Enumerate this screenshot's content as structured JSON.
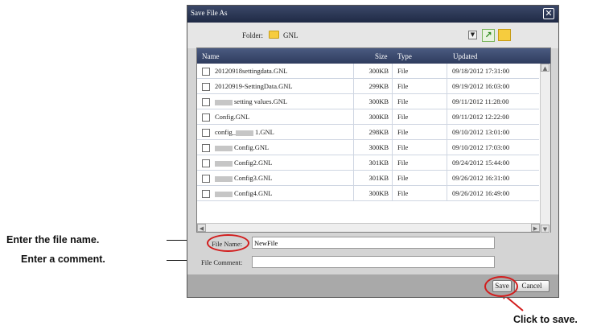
{
  "dialog": {
    "title": "Save File As",
    "close_glyph": "✕"
  },
  "folder": {
    "label": "Folder:",
    "value": "GNL",
    "dropdown_glyph": "▼",
    "up_glyph": "↗"
  },
  "list": {
    "columns": {
      "name": "Name",
      "size": "Size",
      "type": "Type",
      "updated": "Updated"
    },
    "rows": [
      {
        "name": "20120918settingdata.GNL",
        "size": "300KB",
        "type": "File",
        "updated": "09/18/2012 17:31:00"
      },
      {
        "name": "20120919-SettingData.GNL",
        "size": "299KB",
        "type": "File",
        "updated": "09/19/2012 16:03:00"
      },
      {
        "name": "setting values.GNL",
        "size": "300KB",
        "type": "File",
        "updated": "09/11/2012 11:28:00"
      },
      {
        "name": "Config.GNL",
        "size": "300KB",
        "type": "File",
        "updated": "09/11/2012 12:22:00"
      },
      {
        "name": "config_",
        "name_suffix": "1.GNL",
        "size": "298KB",
        "type": "File",
        "updated": "09/10/2012 13:01:00"
      },
      {
        "name": "Config.GNL",
        "size": "300KB",
        "type": "File",
        "updated": "09/10/2012 17:03:00"
      },
      {
        "name": "Config2.GNL",
        "size": "301KB",
        "type": "File",
        "updated": "09/24/2012 15:44:00"
      },
      {
        "name": "Config3.GNL",
        "size": "301KB",
        "type": "File",
        "updated": "09/26/2012 16:31:00"
      },
      {
        "name": "Config4.GNL",
        "size": "300KB",
        "type": "File",
        "updated": "09/26/2012 16:49:00"
      }
    ]
  },
  "form": {
    "file_name_label": "File Name:",
    "file_name_value": "NewFile",
    "file_comment_label": "File Comment:",
    "file_comment_value": ""
  },
  "buttons": {
    "save": "Save",
    "cancel": "Cancel"
  },
  "callouts": {
    "file_name": "Enter the file name.",
    "comment": "Enter a comment.",
    "save": "Click to save."
  },
  "colors": {
    "highlight": "#d21d1d",
    "titlebar": "#2f3c5e"
  }
}
